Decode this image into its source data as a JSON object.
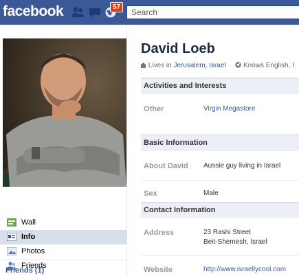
{
  "header": {
    "logo": "facebook",
    "notification_count": "57",
    "search_placeholder": "Search"
  },
  "colors": {
    "brand_blue": "#3b5998",
    "badge_red": "#dd3c10",
    "header_bg": "#eceff5"
  },
  "profile": {
    "name": "David Loeb",
    "lives_prefix": "Lives in",
    "lives_city": "Jerusalem, Israel",
    "knows_text": "Knows English, I"
  },
  "nav": {
    "items": [
      {
        "label": "Wall",
        "icon": "wall-icon"
      },
      {
        "label": "Info",
        "icon": "info-icon"
      },
      {
        "label": "Photos",
        "icon": "photos-icon"
      },
      {
        "label": "Friends",
        "icon": "friends-icon"
      }
    ],
    "friends_link": "Friends (1)"
  },
  "sections": {
    "activities": {
      "title": "Activities and Interests",
      "other_label": "Other",
      "other_value": "Virgin Megastore"
    },
    "basic": {
      "title": "Basic Information",
      "about_label": "About David",
      "about_value": "Aussie guy living in Israel",
      "sex_label": "Sex",
      "sex_value": "Male"
    },
    "contact": {
      "title": "Contact Information",
      "address_label": "Address",
      "address_line1": "23 Rashi Street",
      "address_line2": "Beit-Shemesh, Israel",
      "website_label": "Website",
      "website_value": "http://www.israellycool.com"
    }
  }
}
